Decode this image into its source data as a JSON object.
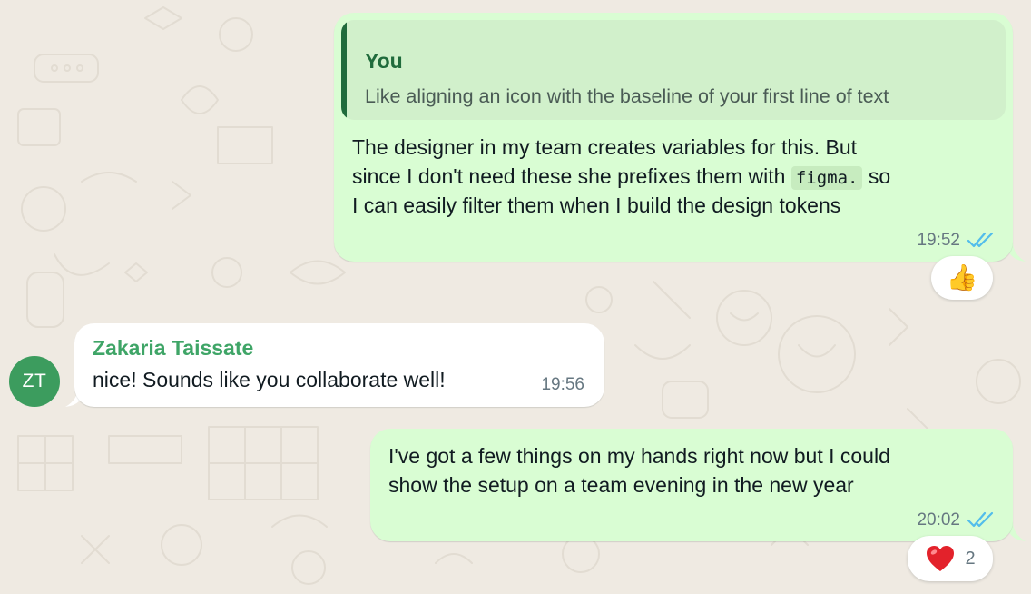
{
  "colors": {
    "background": "#efeae2",
    "outgoing_bubble": "#d9fdd3",
    "incoming_bubble": "#ffffff",
    "quote_accent": "#206b3c",
    "sender_name": "#3fa567",
    "read_ticks": "#53bdeb",
    "avatar": "#3c9c5e"
  },
  "messages": [
    {
      "direction": "outgoing",
      "quoted": {
        "author": "You",
        "text": "Like aligning an icon with the baseline of your first line of text"
      },
      "lines": [
        "The designer in my team creates variables for this. But",
        "since I don't need these she prefixes them with",
        "I can easily filter them when I build the design tokens"
      ],
      "inline_code": "figma.",
      "after_code": "so",
      "time": "19:52",
      "status_icon": "double-check-icon",
      "reaction": {
        "emoji": "👍",
        "icon": "thumbs-up-icon"
      }
    },
    {
      "direction": "incoming",
      "sender": "Zakaria Taissate",
      "avatar_initials": "ZT",
      "text": "nice! Sounds like you collaborate well!",
      "time": "19:56"
    },
    {
      "direction": "outgoing",
      "lines": [
        "I've got a few things on my hands right now but I could",
        "show the setup on a team evening in the new year"
      ],
      "time": "20:02",
      "status_icon": "double-check-icon",
      "reaction": {
        "emoji": "❤️",
        "icon": "red-heart-icon",
        "count": "2"
      }
    }
  ]
}
